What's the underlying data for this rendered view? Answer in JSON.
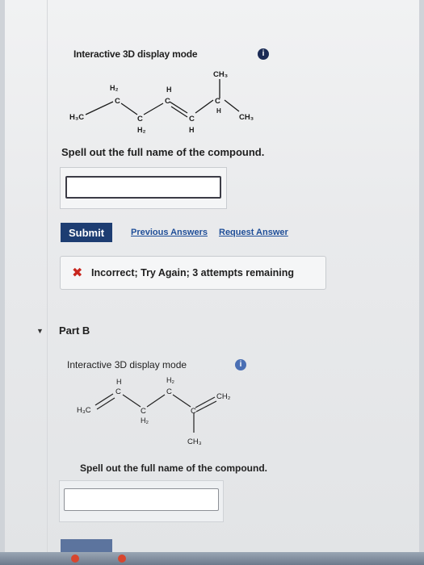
{
  "part_a": {
    "display_mode": "Interactive 3D display mode",
    "info_symbol": "i",
    "prompt": "Spell out the full name of the compound.",
    "answer_value": "",
    "submit_label": "Submit",
    "previous_answers_label": "Previous Answers",
    "request_answer_label": "Request Answer",
    "feedback": {
      "icon": "x-mark-icon",
      "symbol": "✖",
      "text": "Incorrect; Try Again; 3 attempts remaining"
    },
    "molecule_labels": {
      "h3c": "H₃C",
      "h2_top": "H₂",
      "c1": "C",
      "h_mid": "H",
      "c2": "C",
      "c3": "C",
      "h2_bottom": "H₂",
      "c4": "C",
      "h_low": "H",
      "ch3_top": "CH₃",
      "c5": "C",
      "h_small": "H",
      "ch3_right": "CH₃"
    }
  },
  "part_b": {
    "title": "Part B",
    "display_mode": "Interactive 3D display mode",
    "info_symbol": "i",
    "prompt": "Spell out the full name of the compound.",
    "answer_value": "",
    "molecule_labels": {
      "h3c": "H₃C",
      "h_top": "H",
      "c1": "C",
      "c2": "C",
      "h2_bottom": "H₂",
      "h2_top": "H₂",
      "c3": "C",
      "c4": "C",
      "ch2": "CH₂",
      "ch3": "CH₃"
    }
  },
  "colors": {
    "submit": "#1d3d72",
    "link": "#1f4e98",
    "error": "#c8261e",
    "info_dark": "#1b2b55",
    "info_light": "#4a6fb4"
  }
}
